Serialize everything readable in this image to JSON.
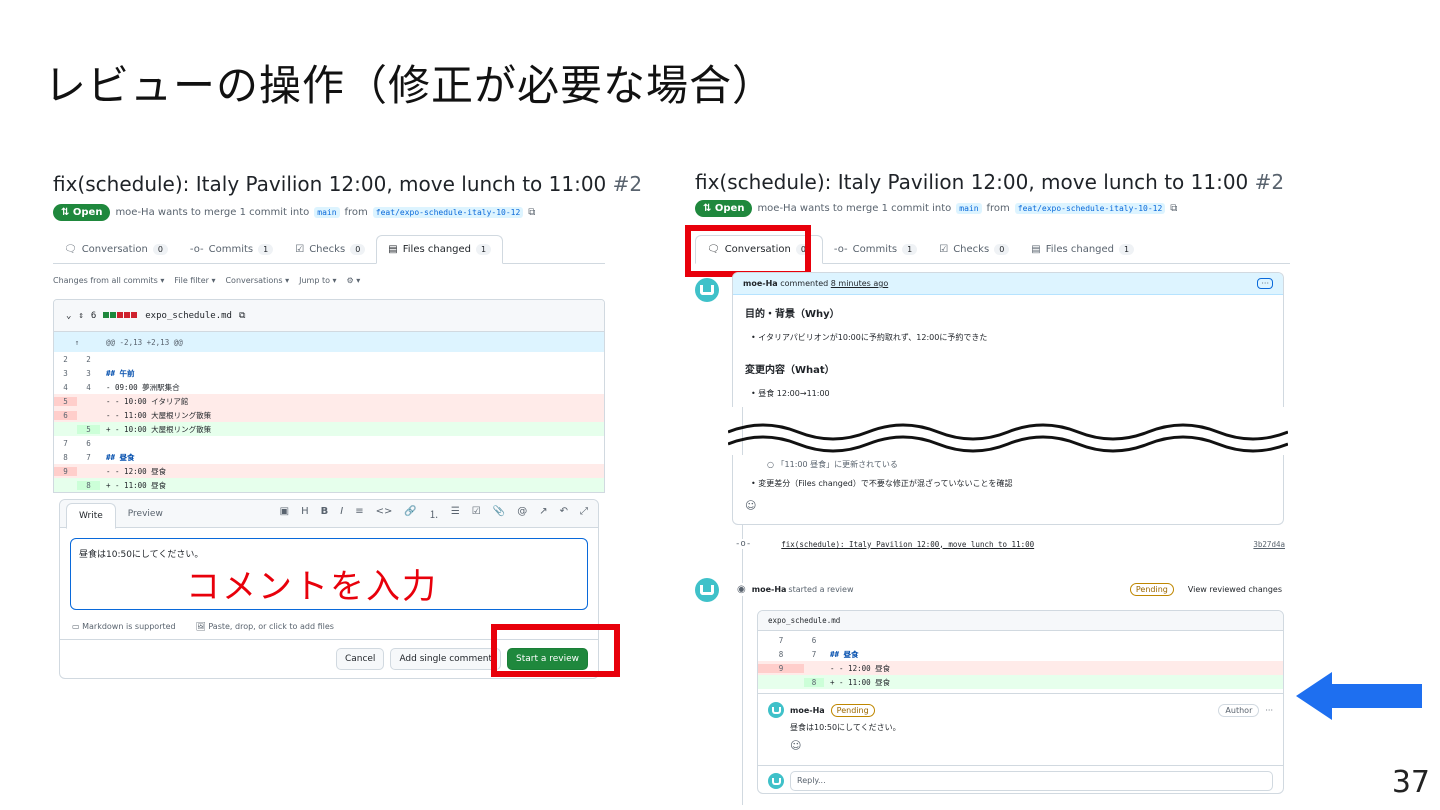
{
  "slide": {
    "title": "レビューの操作（修正が必要な場合）",
    "page_number": "37",
    "annotation": "コメントを入力"
  },
  "left": {
    "pr_title": "fix(schedule): Italy Pavilion 12:00, move lunch to 11:00",
    "pr_number": "#2",
    "status": "Open",
    "meta": "moe-Ha wants to merge 1 commit into",
    "base_branch": "main",
    "from": "from",
    "head_branch": "feat/expo-schedule-italy-10-12",
    "tabs": [
      {
        "label": "Conversation",
        "count": "0"
      },
      {
        "label": "Commits",
        "count": "1"
      },
      {
        "label": "Checks",
        "count": "0"
      },
      {
        "label": "Files changed",
        "count": "1"
      }
    ],
    "toolbar": [
      "Changes from all commits ▾",
      "File filter ▾",
      "Conversations ▾",
      "Jump to ▾",
      "⚙ ▾"
    ],
    "file": {
      "changes": "6",
      "name": "expo_schedule.md"
    },
    "hunk": "@@ -2,13 +2,13 @@",
    "diff": [
      {
        "type": "ctx",
        "old": "2",
        "new": "2",
        "text": ""
      },
      {
        "type": "ctx",
        "old": "3",
        "new": "3",
        "text": "## 午前"
      },
      {
        "type": "ctx",
        "old": "4",
        "new": "4",
        "text": "- 09:00 夢洲駅集合"
      },
      {
        "type": "del",
        "old": "5",
        "new": "",
        "text": "- - 10:00 イタリア館"
      },
      {
        "type": "del",
        "old": "6",
        "new": "",
        "text": "- - 11:00 大屋根リング散策"
      },
      {
        "type": "add",
        "old": "",
        "new": "5",
        "text": "+ - 10:00 大屋根リング散策"
      },
      {
        "type": "ctx",
        "old": "7",
        "new": "6",
        "text": ""
      },
      {
        "type": "ctx",
        "old": "8",
        "new": "7",
        "text": "## 昼食"
      },
      {
        "type": "del",
        "old": "9",
        "new": "",
        "text": "- - 12:00 昼食"
      },
      {
        "type": "add",
        "old": "",
        "new": "8",
        "text": "+ - 11:00 昼食"
      }
    ],
    "editor": {
      "write": "Write",
      "preview": "Preview",
      "comment": "昼食は10:50にしてください。",
      "markdown": "Markdown is supported",
      "attach": "Paste, drop, or click to add files",
      "cancel": "Cancel",
      "add_single": "Add single comment",
      "start_review": "Start a review"
    }
  },
  "right": {
    "pr_title": "fix(schedule): Italy Pavilion 12:00, move lunch to 11:00",
    "pr_number": "#2",
    "status": "Open",
    "meta": "moe-Ha wants to merge 1 commit into",
    "base_branch": "main",
    "from": "from",
    "head_branch": "feat/expo-schedule-italy-10-12",
    "tabs": [
      {
        "label": "Conversation",
        "count": "0"
      },
      {
        "label": "Commits",
        "count": "1"
      },
      {
        "label": "Checks",
        "count": "0"
      },
      {
        "label": "Files changed",
        "count": "1"
      }
    ],
    "comment": {
      "author": "moe-Ha",
      "action": "commented",
      "time": "8 minutes ago",
      "h1": "目的・背景（Why）",
      "li1": "イタリアパビリオンが10:00に予約取れず、12:00に予約できた",
      "h2": "変更内容（What）",
      "li2": "昼食 12:00→11:00",
      "li3": "「11:00 昼食」に更新されている",
      "li4": "変更差分（Files changed）で不要な修正が混ざっていないことを確認"
    },
    "commit": {
      "message": "fix(schedule): Italy Pavilion 12:00, move lunch to 11:00",
      "sha": "3b27d4a"
    },
    "review": {
      "author": "moe-Ha",
      "action": "started a review",
      "pending": "Pending",
      "view": "View reviewed changes",
      "file": "expo_schedule.md",
      "diff": [
        {
          "type": "ctx",
          "old": "7",
          "new": "6",
          "text": ""
        },
        {
          "type": "ctx",
          "old": "8",
          "new": "7",
          "text": "## 昼食"
        },
        {
          "type": "del",
          "old": "9",
          "new": "",
          "text": "- - 12:00 昼食"
        },
        {
          "type": "add",
          "old": "",
          "new": "8",
          "text": "+ - 11:00 昼食"
        }
      ],
      "c_author": "moe-Ha",
      "c_pending": "Pending",
      "c_role": "Author",
      "c_text": "昼食は10:50にしてください。",
      "reply": "Reply..."
    }
  }
}
